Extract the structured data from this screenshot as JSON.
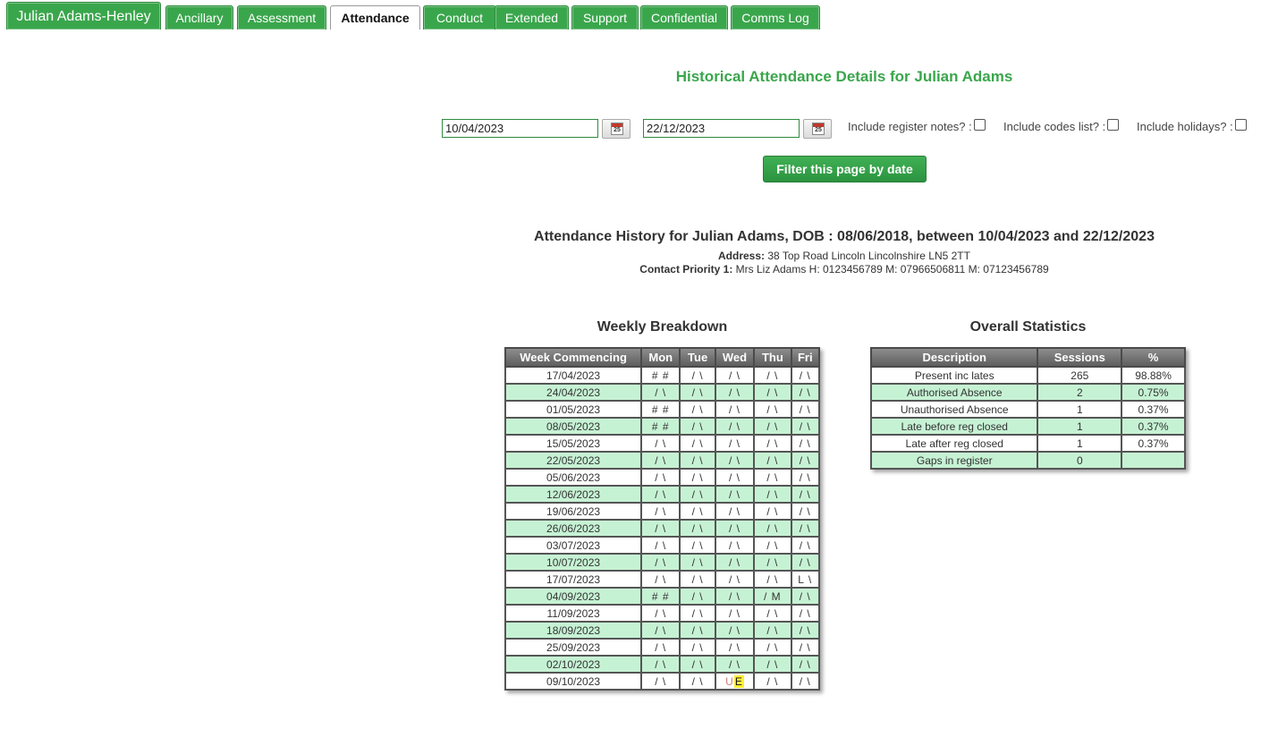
{
  "tabs": [
    {
      "label": "Julian Adams-Henley",
      "active": false,
      "main": true
    },
    {
      "label": "Ancillary",
      "active": false
    },
    {
      "label": "Assessment",
      "active": false
    },
    {
      "label": "Attendance",
      "active": true
    },
    {
      "label": "Conduct",
      "active": false
    },
    {
      "label": "Extended",
      "active": false
    },
    {
      "label": "Support",
      "active": false
    },
    {
      "label": "Confidential",
      "active": false
    },
    {
      "label": "Comms Log",
      "active": false
    }
  ],
  "page_title": "Historical Attendance Details for Julian Adams",
  "filter": {
    "from_date": "10/04/2023",
    "to_date": "22/12/2023",
    "calendar_icon_text": "25",
    "opt_register_notes": "Include register notes? :",
    "opt_codes_list": "Include codes list? :",
    "opt_holidays": "Include holidays? :",
    "button": "Filter this page by date"
  },
  "history": {
    "title": "Attendance History for Julian Adams, DOB : 08/06/2018, between 10/04/2023 and 22/12/2023",
    "address_label": "Address:",
    "address_value": "38 Top Road Lincoln Lincolnshire LN5 2TT",
    "contact_label": "Contact Priority 1:",
    "contact_value": "Mrs Liz Adams H: 0123456789 M: 07966506811 M: 07123456789"
  },
  "weekly": {
    "title": "Weekly Breakdown",
    "headers": [
      "Week Commencing",
      "Mon",
      "Tue",
      "Wed",
      "Thu",
      "Fri"
    ],
    "rows": [
      [
        "17/04/2023",
        "# #",
        "/ \\",
        "/ \\",
        "/ \\",
        "/ \\"
      ],
      [
        "24/04/2023",
        "/ \\",
        "/ \\",
        "/ \\",
        "/ \\",
        "/ \\"
      ],
      [
        "01/05/2023",
        "# #",
        "/ \\",
        "/ \\",
        "/ \\",
        "/ \\"
      ],
      [
        "08/05/2023",
        "# #",
        "/ \\",
        "/ \\",
        "/ \\",
        "/ \\"
      ],
      [
        "15/05/2023",
        "/ \\",
        "/ \\",
        "/ \\",
        "/ \\",
        "/ \\"
      ],
      [
        "22/05/2023",
        "/ \\",
        "/ \\",
        "/ \\",
        "/ \\",
        "/ \\"
      ],
      [
        "05/06/2023",
        "/ \\",
        "/ \\",
        "/ \\",
        "/ \\",
        "/ \\"
      ],
      [
        "12/06/2023",
        "/ \\",
        "/ \\",
        "/ \\",
        "/ \\",
        "/ \\"
      ],
      [
        "19/06/2023",
        "/ \\",
        "/ \\",
        "/ \\",
        "/ \\",
        "/ \\"
      ],
      [
        "26/06/2023",
        "/ \\",
        "/ \\",
        "/ \\",
        "/ \\",
        "/ \\"
      ],
      [
        "03/07/2023",
        "/ \\",
        "/ \\",
        "/ \\",
        "/ \\",
        "/ \\"
      ],
      [
        "10/07/2023",
        "/ \\",
        "/ \\",
        "/ \\",
        "/ \\",
        "/ \\"
      ],
      [
        "17/07/2023",
        "/ \\",
        "/ \\",
        "/ \\",
        "/ \\",
        "L \\"
      ],
      [
        "04/09/2023",
        "# #",
        "/ \\",
        "/ \\",
        "/ M",
        "/ \\"
      ],
      [
        "11/09/2023",
        "/ \\",
        "/ \\",
        "/ \\",
        "/ \\",
        "/ \\"
      ],
      [
        "18/09/2023",
        "/ \\",
        "/ \\",
        "/ \\",
        "/ \\",
        "/ \\"
      ],
      [
        "25/09/2023",
        "/ \\",
        "/ \\",
        "/ \\",
        "/ \\",
        "/ \\"
      ],
      [
        "02/10/2023",
        "/ \\",
        "/ \\",
        "/ \\",
        "/ \\",
        "/ \\"
      ],
      [
        "09/10/2023",
        "/ \\",
        "/ \\",
        "U E",
        "/ \\",
        "/ \\"
      ]
    ]
  },
  "overall": {
    "title": "Overall Statistics",
    "headers": [
      "Description",
      "Sessions",
      "%"
    ],
    "rows": [
      [
        "Present inc lates",
        "265",
        "98.88%"
      ],
      [
        "Authorised Absence",
        "2",
        "0.75%"
      ],
      [
        "Unauthorised Absence",
        "1",
        "0.37%"
      ],
      [
        "Late before reg closed",
        "1",
        "0.37%"
      ],
      [
        "Late after reg closed",
        "1",
        "0.37%"
      ],
      [
        "Gaps in register",
        "0",
        ""
      ]
    ]
  },
  "colors": {
    "accent": "#3aa64c",
    "row_alt": "#c6f2d4",
    "header": "#6e6e6e",
    "gap_value": "#e00000",
    "highlight": "#ffee33"
  }
}
